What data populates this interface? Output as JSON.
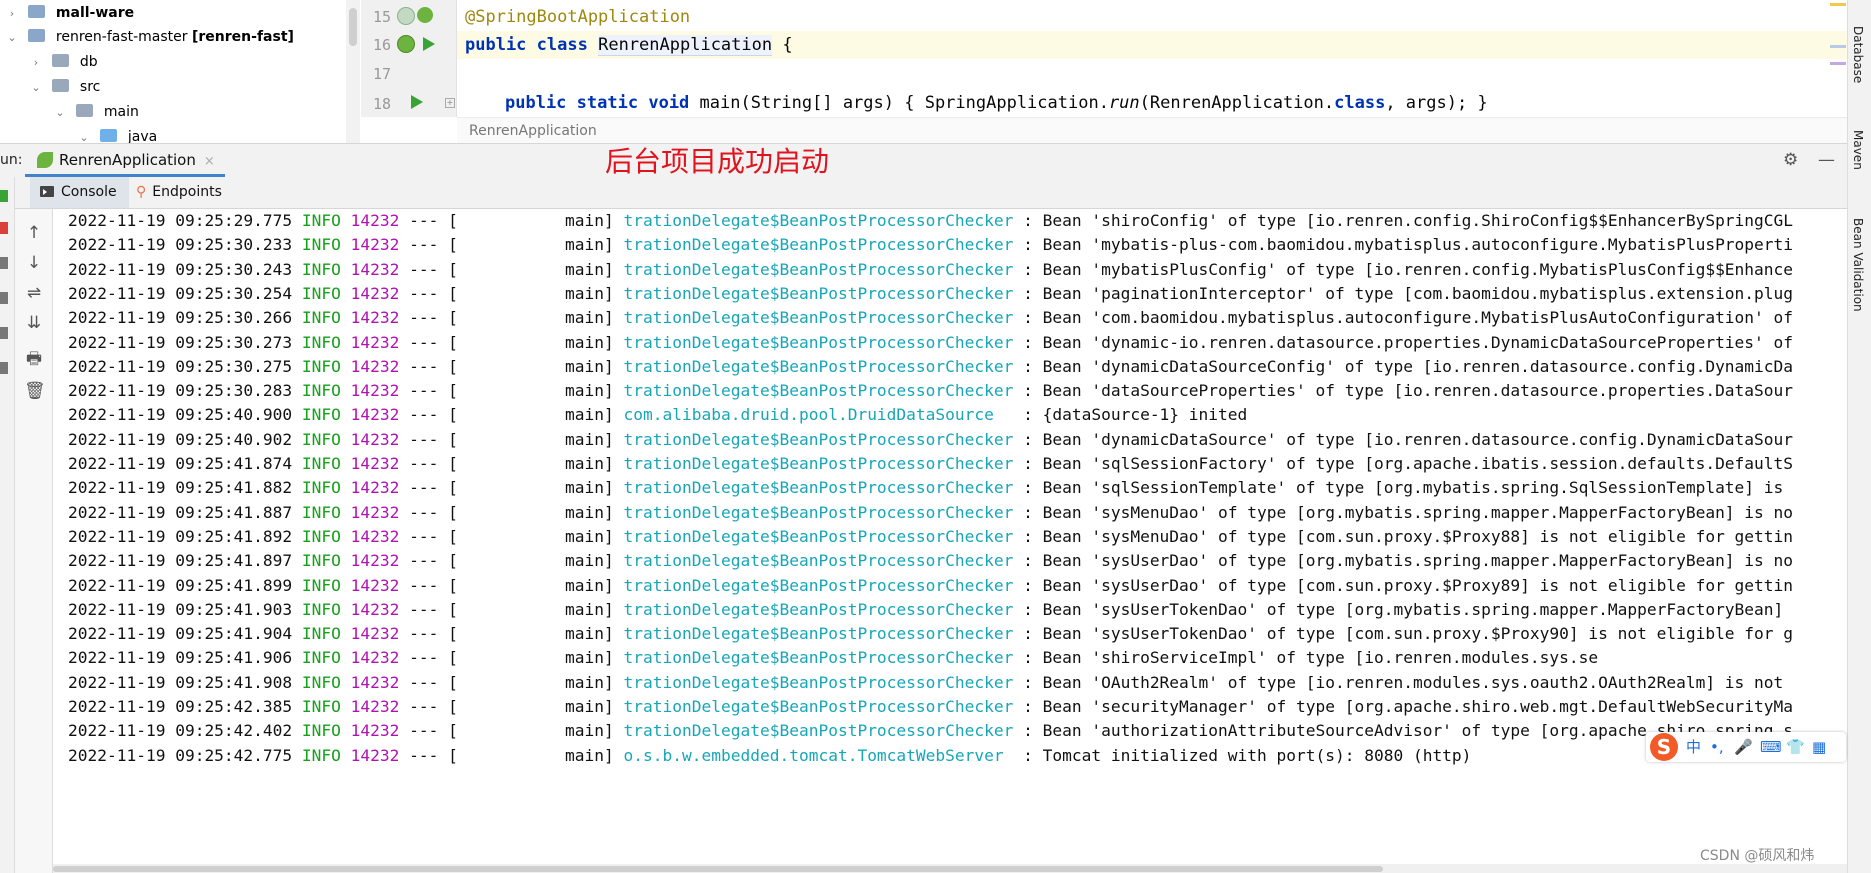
{
  "project_tree": {
    "items": [
      {
        "label": "mall-ware",
        "arrow": "›",
        "bold": true,
        "icon": "module-folder-icon"
      },
      {
        "label": "renren-fast-master",
        "suffix": "[renren-fast]",
        "arrow": "⌄",
        "icon": "module-folder-icon"
      },
      {
        "label": "db",
        "arrow": "›",
        "icon": "folder-icon"
      },
      {
        "label": "src",
        "arrow": "⌄",
        "icon": "folder-icon"
      },
      {
        "label": "main",
        "arrow": "⌄",
        "icon": "folder-icon"
      },
      {
        "label": "java",
        "arrow": "⌄",
        "icon": "source-folder-icon"
      }
    ]
  },
  "editor": {
    "line_numbers": [
      "15",
      "16",
      "17",
      "18"
    ],
    "lines": {
      "l15": {
        "annotation": "@SpringBootApplication"
      },
      "l16": {
        "kw1": "public",
        "kw2": "class",
        "cls": "RenrenApplication",
        "brace": " {"
      },
      "l18": {
        "kw1": "public",
        "kw2": "static",
        "kw3": "void",
        "sig": " main(String[] args) ",
        "body_open": "{ SpringApplication.",
        "run": "run",
        "arg1": "(RenrenApplication",
        "dot": ".",
        "kw_class": "class",
        "rest": ", args); }"
      }
    },
    "breadcrumb": "RenrenApplication"
  },
  "right_panel_tabs": [
    "Database",
    "Maven",
    "Bean Validation"
  ],
  "run_window": {
    "label": "un:",
    "tab_label": "RenrenApplication",
    "tab_close": "×",
    "subtabs": {
      "console": "Console",
      "endpoints": "Endpoints"
    },
    "settings_icon": "⚙",
    "minimize_icon": "—"
  },
  "annotation_text": "后台项目成功启动",
  "toolbar_icons": [
    "↑",
    "↓",
    "⇌",
    "⇊",
    "🖶",
    "🗑"
  ],
  "log_lines": [
    {
      "ts": "2022-11-19 09:25:29.775",
      "lvl": "INFO",
      "pid": "14232",
      "sep": " --- [",
      "thread": "           main] ",
      "logger": "trationDelegate$BeanPostProcessorChecker",
      "msg": " : Bean 'shiroConfig' of type [io.renren.config.ShiroConfig$$EnhancerBySpringCGL"
    },
    {
      "ts": "2022-11-19 09:25:30.233",
      "lvl": "INFO",
      "pid": "14232",
      "sep": " --- [",
      "thread": "           main] ",
      "logger": "trationDelegate$BeanPostProcessorChecker",
      "msg": " : Bean 'mybatis-plus-com.baomidou.mybatisplus.autoconfigure.MybatisPlusProperti"
    },
    {
      "ts": "2022-11-19 09:25:30.243",
      "lvl": "INFO",
      "pid": "14232",
      "sep": " --- [",
      "thread": "           main] ",
      "logger": "trationDelegate$BeanPostProcessorChecker",
      "msg": " : Bean 'mybatisPlusConfig' of type [io.renren.config.MybatisPlusConfig$$Enhance"
    },
    {
      "ts": "2022-11-19 09:25:30.254",
      "lvl": "INFO",
      "pid": "14232",
      "sep": " --- [",
      "thread": "           main] ",
      "logger": "trationDelegate$BeanPostProcessorChecker",
      "msg": " : Bean 'paginationInterceptor' of type [com.baomidou.mybatisplus.extension.plug"
    },
    {
      "ts": "2022-11-19 09:25:30.266",
      "lvl": "INFO",
      "pid": "14232",
      "sep": " --- [",
      "thread": "           main] ",
      "logger": "trationDelegate$BeanPostProcessorChecker",
      "msg": " : Bean 'com.baomidou.mybatisplus.autoconfigure.MybatisPlusAutoConfiguration' of"
    },
    {
      "ts": "2022-11-19 09:25:30.273",
      "lvl": "INFO",
      "pid": "14232",
      "sep": " --- [",
      "thread": "           main] ",
      "logger": "trationDelegate$BeanPostProcessorChecker",
      "msg": " : Bean 'dynamic-io.renren.datasource.properties.DynamicDataSourceProperties' of"
    },
    {
      "ts": "2022-11-19 09:25:30.275",
      "lvl": "INFO",
      "pid": "14232",
      "sep": " --- [",
      "thread": "           main] ",
      "logger": "trationDelegate$BeanPostProcessorChecker",
      "msg": " : Bean 'dynamicDataSourceConfig' of type [io.renren.datasource.config.DynamicDa"
    },
    {
      "ts": "2022-11-19 09:25:30.283",
      "lvl": "INFO",
      "pid": "14232",
      "sep": " --- [",
      "thread": "           main] ",
      "logger": "trationDelegate$BeanPostProcessorChecker",
      "msg": " : Bean 'dataSourceProperties' of type [io.renren.datasource.properties.DataSour"
    },
    {
      "ts": "2022-11-19 09:25:40.900",
      "lvl": "INFO",
      "pid": "14232",
      "sep": " --- [",
      "thread": "           main] ",
      "logger": "com.alibaba.druid.pool.DruidDataSource  ",
      "msg": " : {dataSource-1} inited"
    },
    {
      "ts": "2022-11-19 09:25:40.902",
      "lvl": "INFO",
      "pid": "14232",
      "sep": " --- [",
      "thread": "           main] ",
      "logger": "trationDelegate$BeanPostProcessorChecker",
      "msg": " : Bean 'dynamicDataSource' of type [io.renren.datasource.config.DynamicDataSour"
    },
    {
      "ts": "2022-11-19 09:25:41.874",
      "lvl": "INFO",
      "pid": "14232",
      "sep": " --- [",
      "thread": "           main] ",
      "logger": "trationDelegate$BeanPostProcessorChecker",
      "msg": " : Bean 'sqlSessionFactory' of type [org.apache.ibatis.session.defaults.DefaultS"
    },
    {
      "ts": "2022-11-19 09:25:41.882",
      "lvl": "INFO",
      "pid": "14232",
      "sep": " --- [",
      "thread": "           main] ",
      "logger": "trationDelegate$BeanPostProcessorChecker",
      "msg": " : Bean 'sqlSessionTemplate' of type [org.mybatis.spring.SqlSessionTemplate] is"
    },
    {
      "ts": "2022-11-19 09:25:41.887",
      "lvl": "INFO",
      "pid": "14232",
      "sep": " --- [",
      "thread": "           main] ",
      "logger": "trationDelegate$BeanPostProcessorChecker",
      "msg": " : Bean 'sysMenuDao' of type [org.mybatis.spring.mapper.MapperFactoryBean] is no"
    },
    {
      "ts": "2022-11-19 09:25:41.892",
      "lvl": "INFO",
      "pid": "14232",
      "sep": " --- [",
      "thread": "           main] ",
      "logger": "trationDelegate$BeanPostProcessorChecker",
      "msg": " : Bean 'sysMenuDao' of type [com.sun.proxy.$Proxy88] is not eligible for gettin"
    },
    {
      "ts": "2022-11-19 09:25:41.897",
      "lvl": "INFO",
      "pid": "14232",
      "sep": " --- [",
      "thread": "           main] ",
      "logger": "trationDelegate$BeanPostProcessorChecker",
      "msg": " : Bean 'sysUserDao' of type [org.mybatis.spring.mapper.MapperFactoryBean] is no"
    },
    {
      "ts": "2022-11-19 09:25:41.899",
      "lvl": "INFO",
      "pid": "14232",
      "sep": " --- [",
      "thread": "           main] ",
      "logger": "trationDelegate$BeanPostProcessorChecker",
      "msg": " : Bean 'sysUserDao' of type [com.sun.proxy.$Proxy89] is not eligible for gettin"
    },
    {
      "ts": "2022-11-19 09:25:41.903",
      "lvl": "INFO",
      "pid": "14232",
      "sep": " --- [",
      "thread": "           main] ",
      "logger": "trationDelegate$BeanPostProcessorChecker",
      "msg": " : Bean 'sysUserTokenDao' of type [org.mybatis.spring.mapper.MapperFactoryBean]"
    },
    {
      "ts": "2022-11-19 09:25:41.904",
      "lvl": "INFO",
      "pid": "14232",
      "sep": " --- [",
      "thread": "           main] ",
      "logger": "trationDelegate$BeanPostProcessorChecker",
      "msg": " : Bean 'sysUserTokenDao' of type [com.sun.proxy.$Proxy90] is not eligible for g"
    },
    {
      "ts": "2022-11-19 09:25:41.906",
      "lvl": "INFO",
      "pid": "14232",
      "sep": " --- [",
      "thread": "           main] ",
      "logger": "trationDelegate$BeanPostProcessorChecker",
      "msg": " : Bean 'shiroServiceImpl' of type [io.renren.modules.sys.se"
    },
    {
      "ts": "2022-11-19 09:25:41.908",
      "lvl": "INFO",
      "pid": "14232",
      "sep": " --- [",
      "thread": "           main] ",
      "logger": "trationDelegate$BeanPostProcessorChecker",
      "msg": " : Bean 'OAuth2Realm' of type [io.renren.modules.sys.oauth2.OAuth2Realm] is not"
    },
    {
      "ts": "2022-11-19 09:25:42.385",
      "lvl": "INFO",
      "pid": "14232",
      "sep": " --- [",
      "thread": "           main] ",
      "logger": "trationDelegate$BeanPostProcessorChecker",
      "msg": " : Bean 'securityManager' of type [org.apache.shiro.web.mgt.DefaultWebSecurityMa"
    },
    {
      "ts": "2022-11-19 09:25:42.402",
      "lvl": "INFO",
      "pid": "14232",
      "sep": " --- [",
      "thread": "           main] ",
      "logger": "trationDelegate$BeanPostProcessorChecker",
      "msg": " : Bean 'authorizationAttributeSourceAdvisor' of type [org.apache.shiro.spring.s"
    },
    {
      "ts": "2022-11-19 09:25:42.775",
      "lvl": "INFO",
      "pid": "14232",
      "sep": " --- [",
      "thread": "           main] ",
      "logger": "o.s.b.w.embedded.tomcat.TomcatWebServer ",
      "msg": " : Tomcat initialized with port(s): 8080 (http)"
    }
  ],
  "ime_toolbar": {
    "logo": "S",
    "items": [
      "中",
      "•,",
      "🎤",
      "⌨",
      "👕",
      "▦"
    ]
  },
  "watermark": "CSDN @硕风和炜",
  "colors": {
    "info": "#16a01b",
    "pid": "#b013b0",
    "logger": "#17a6b8",
    "annotation": "#e0141e",
    "keyword": "#0033b3",
    "spring_annotation": "#9e880d"
  }
}
